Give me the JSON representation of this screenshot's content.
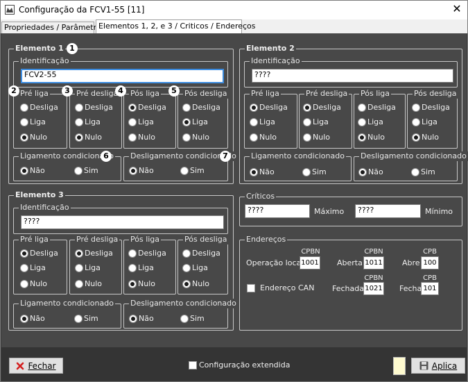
{
  "window": {
    "title": "Configuração da FCV1-55  [11]",
    "close_glyph": "✕"
  },
  "tabs": [
    {
      "label": "Propriedades / Parâmetros"
    },
    {
      "label": "Elementos 1, 2, e 3 / Criticos / Endereços"
    }
  ],
  "badges": [
    "1",
    "2",
    "3",
    "4",
    "5",
    "6",
    "7"
  ],
  "section_labels": {
    "identificacao": "Identificação",
    "pre_liga": "Pré liga",
    "pre_desliga": "Pré desliga",
    "pos_liga": "Pós liga",
    "pos_desliga": "Pós desliga",
    "ligamento": "Ligamento condicionado",
    "desligamento": "Desligamento condicionado"
  },
  "options": {
    "desliga": "Desliga",
    "liga": "Liga",
    "nulo": "Nulo",
    "nao": "Não",
    "sim": "Sim"
  },
  "elemento1": {
    "title": "Elemento 1",
    "identificacao": "FCV2-55"
  },
  "elemento2": {
    "title": "Elemento 2",
    "identificacao": "????"
  },
  "elemento3": {
    "title": "Elemento 3",
    "identificacao": "????"
  },
  "criticos": {
    "title": "Críticos",
    "maximo_value": "????",
    "maximo_label": "Máximo",
    "minimo_value": "????",
    "minimo_label": "Mínimo"
  },
  "enderecos": {
    "title": "Endereços",
    "operacao_local": {
      "label": "Operação local",
      "tag": "CPBN",
      "value": "1001"
    },
    "aberta": {
      "label": "Aberta",
      "tag": "CPBN",
      "value": "1011"
    },
    "abre": {
      "label": "Abre",
      "tag": "CPB",
      "value": "100"
    },
    "endereco_can": {
      "label": "Endereço CAN",
      "checked": false
    },
    "fechada": {
      "label": "Fechada",
      "tag": "CPBN",
      "value": "1021"
    },
    "fecha": {
      "label": "Fecha",
      "tag": "CPB",
      "value": "101"
    }
  },
  "footer": {
    "fechar_label": "Fechar",
    "config_extendida": "Configuração extendida",
    "config_extendida_checked": false,
    "aplica_label": "Aplica",
    "swatch_color": "#fffbd0"
  }
}
